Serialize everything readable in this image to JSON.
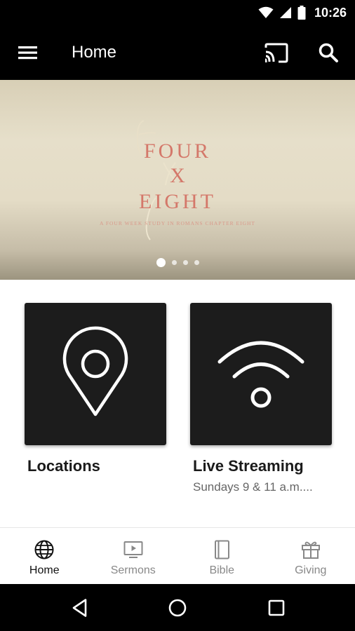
{
  "status_bar": {
    "time": "10:26"
  },
  "app_bar": {
    "title": "Home"
  },
  "banner": {
    "lines": [
      "FOUR",
      "X",
      "EIGHT"
    ],
    "subtitle": "A FOUR WEEK STUDY IN ROMANS CHAPTER EIGHT",
    "script_word": "Four Eight",
    "slide_count": 4,
    "active_slide": 1
  },
  "cards": [
    {
      "title": "Locations",
      "subtitle": "",
      "icon": "location-pin-icon"
    },
    {
      "title": "Live Streaming",
      "subtitle": "Sundays 9 & 11 a.m....",
      "icon": "wifi-signal-icon"
    }
  ],
  "bottom_nav": [
    {
      "label": "Home",
      "icon": "globe-icon",
      "active": true
    },
    {
      "label": "Sermons",
      "icon": "tv-play-icon",
      "active": false
    },
    {
      "label": "Bible",
      "icon": "book-icon",
      "active": false
    },
    {
      "label": "Giving",
      "icon": "gift-icon",
      "active": false
    }
  ],
  "colors": {
    "bar": "#000000",
    "card": "#1c1c1c",
    "title_accent": "#d47a6a"
  }
}
